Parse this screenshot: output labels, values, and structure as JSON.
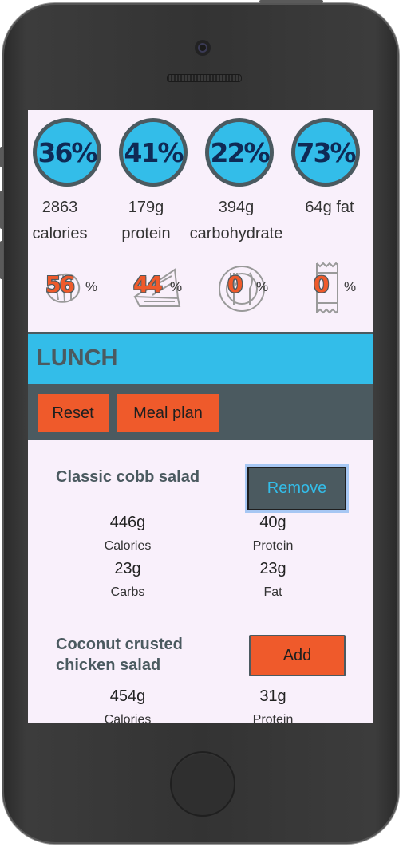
{
  "rings": [
    "36%",
    "41%",
    "22%",
    "73%"
  ],
  "stats": [
    {
      "line1": "2863",
      "line2": "calories"
    },
    {
      "line1": "179g",
      "line2": "protein"
    },
    {
      "line1": "394g",
      "line2": "carbohydrate"
    },
    {
      "line1": "64g fat",
      "line2": ""
    }
  ],
  "mini": [
    {
      "icon": "croissant-icon",
      "value": "56",
      "sign": "%"
    },
    {
      "icon": "sandwich-icon",
      "value": "44",
      "sign": "%"
    },
    {
      "icon": "plate-cutlery-icon",
      "value": "0",
      "sign": "%"
    },
    {
      "icon": "snack-bar-icon",
      "value": "0",
      "sign": "%"
    }
  ],
  "section": {
    "title": "LUNCH"
  },
  "toolbar": {
    "reset_label": "Reset",
    "meal_plan_label": "Meal plan"
  },
  "items": [
    {
      "name": "Classic cobb salad",
      "action": "Remove",
      "calories": "446g",
      "calories_label": "Calories",
      "protein": "40g",
      "protein_label": "Protein",
      "carbs": "23g",
      "carbs_label": "Carbs",
      "fat": "23g",
      "fat_label": "Fat"
    },
    {
      "name_line1": "Coconut crusted",
      "name_line2": "chicken salad",
      "action": "Add",
      "calories": "454g",
      "calories_label": "Calories",
      "protein": "31g",
      "protein_label": "Protein"
    }
  ],
  "colors": {
    "accent_blue": "#33bde9",
    "accent_orange": "#ef5a2b",
    "slate": "#4b5a60",
    "screen_bg": "#f9f0fb"
  }
}
